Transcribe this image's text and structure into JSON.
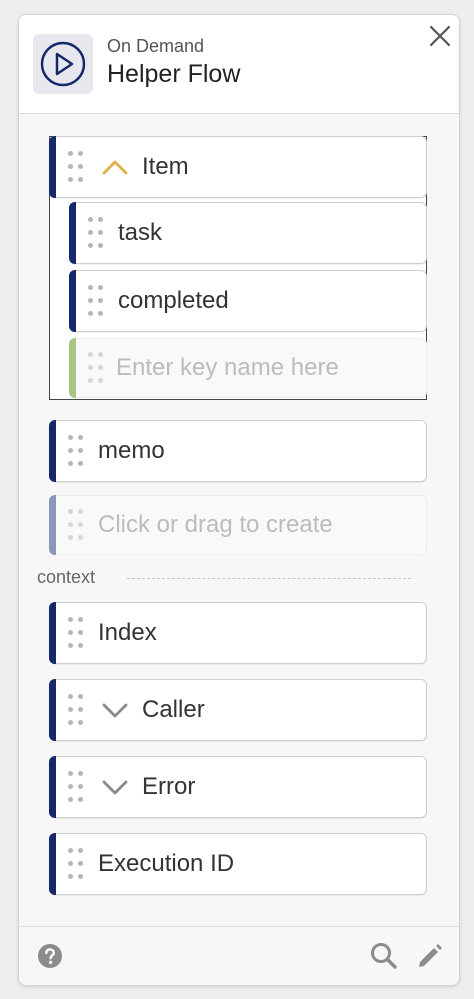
{
  "header": {
    "subtitle": "On Demand",
    "title": "Helper Flow",
    "icon": "play-circle-icon",
    "accent": "#16286b"
  },
  "group": {
    "label": "Item",
    "expanded": true,
    "children": [
      "task",
      "completed"
    ],
    "new_key_placeholder": "Enter key name here"
  },
  "fields": {
    "memo": "memo",
    "create_placeholder": "Click or drag to create"
  },
  "context": {
    "label": "context",
    "items": [
      {
        "label": "Index",
        "expandable": false
      },
      {
        "label": "Caller",
        "expandable": true
      },
      {
        "label": "Error",
        "expandable": true
      },
      {
        "label": "Execution ID",
        "expandable": false
      }
    ]
  },
  "footer": {
    "icons": [
      "help-icon",
      "search-icon",
      "edit-icon"
    ]
  },
  "colors": {
    "bar_dark": "#16286b",
    "bar_light": "#8b97b8",
    "bar_green": "#a8c584",
    "chevron_up": "#e2b04a",
    "chevron_down": "#8a8a8a"
  }
}
